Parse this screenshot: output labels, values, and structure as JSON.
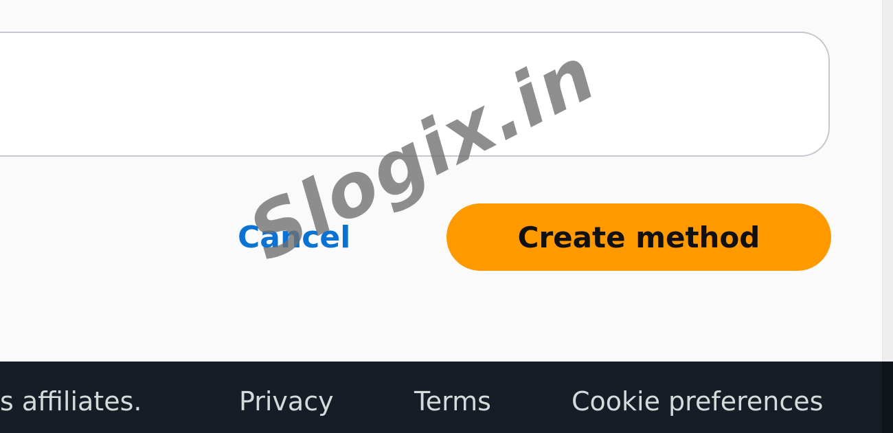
{
  "form": {
    "textarea_value": "",
    "cancel_label": "Cancel",
    "submit_label": "Create method"
  },
  "footer": {
    "copyright_fragment": "s affiliates.",
    "privacy_label": "Privacy",
    "terms_label": "Terms",
    "cookie_label": "Cookie preferences"
  },
  "watermark": {
    "text": "Slogix.in"
  },
  "colors": {
    "primary_button": "#ff9900",
    "link": "#0972d3",
    "footer_background": "#161d26",
    "footer_text": "#d5dbdb",
    "watermark": "#6e6e6e"
  }
}
